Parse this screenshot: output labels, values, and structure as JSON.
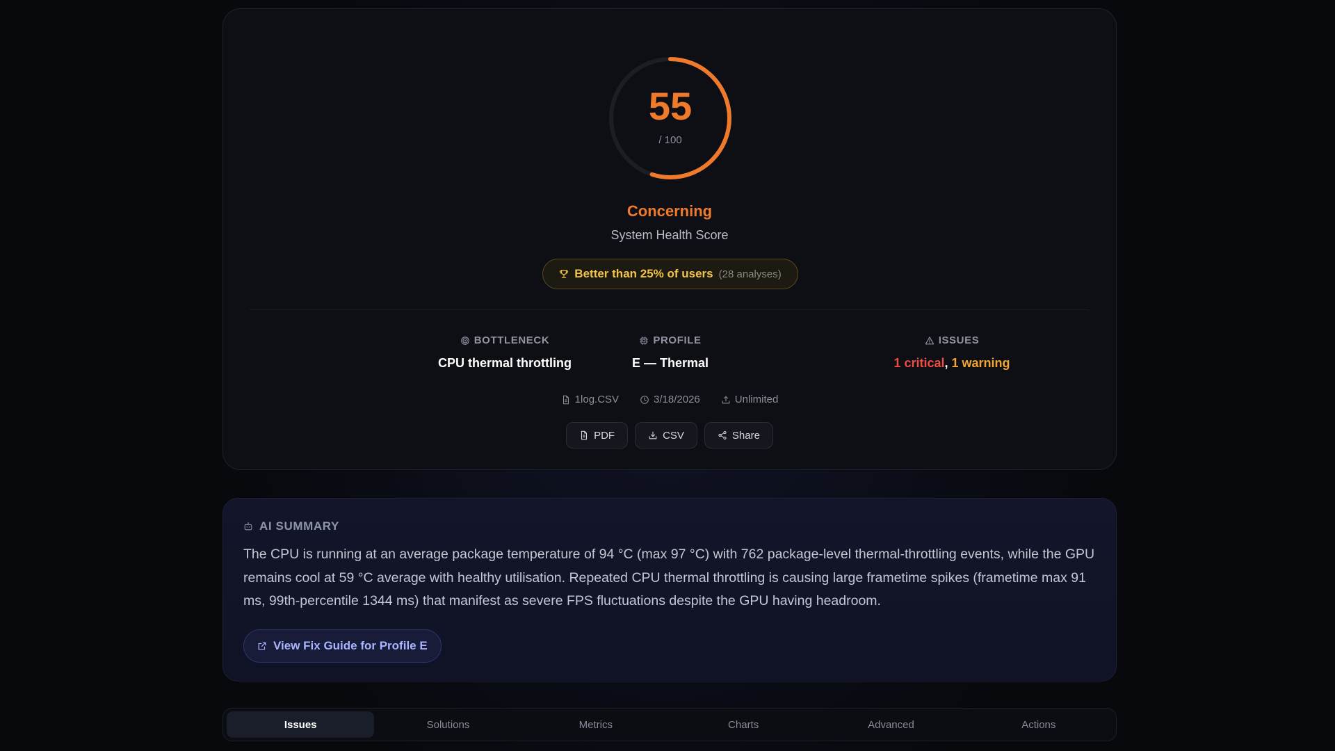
{
  "score": {
    "value": "55",
    "max_label": "/ 100",
    "fraction": 0.55,
    "status": "Concerning",
    "subtitle": "System Health Score",
    "accent_color": "#f07a2c"
  },
  "ranking": {
    "icon": "trophy-icon",
    "text": "Better than 25% of users",
    "count": "(28 analyses)"
  },
  "stats": {
    "bottleneck": {
      "icon": "target-icon",
      "label": "BOTTLENECK",
      "value": "CPU thermal throttling"
    },
    "profile": {
      "icon": "cpu-chip-icon",
      "label": "PROFILE",
      "value": "E — Thermal"
    },
    "issues": {
      "icon": "warning-triangle-icon",
      "label": "ISSUES",
      "critical": "1 critical",
      "separator": ",",
      "warning": "1 warning"
    }
  },
  "meta": {
    "file": "1log.CSV",
    "date": "3/18/2026",
    "plan": "Unlimited"
  },
  "actions": {
    "pdf": "PDF",
    "csv": "CSV",
    "share": "Share"
  },
  "summary": {
    "icon": "bot-icon",
    "title": "AI SUMMARY",
    "text": "The CPU is running at an average package temperature of 94 °C (max 97 °C) with 762 package-level thermal-throttling events, while the GPU remains cool at 59 °C average with healthy utilisation. Repeated CPU thermal throttling is causing large frametime spikes (frametime max 91 ms, 99th-percentile 1344 ms) that manifest as severe FPS fluctuations despite the GPU having headroom.",
    "fix_button": "View Fix Guide for Profile E"
  },
  "tabs": [
    {
      "label": "Issues",
      "active": true
    },
    {
      "label": "Solutions",
      "active": false
    },
    {
      "label": "Metrics",
      "active": false
    },
    {
      "label": "Charts",
      "active": false
    },
    {
      "label": "Advanced",
      "active": false
    },
    {
      "label": "Actions",
      "active": false
    }
  ]
}
